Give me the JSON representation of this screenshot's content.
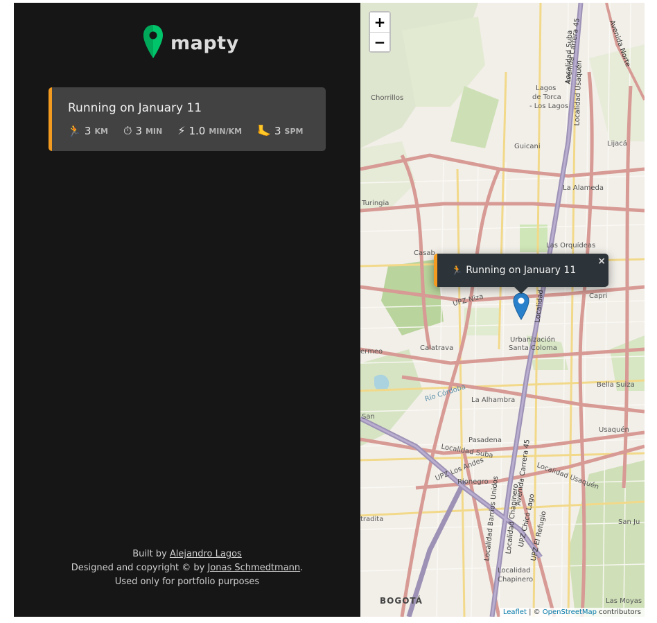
{
  "app": {
    "logo_text": "mapty"
  },
  "workouts": [
    {
      "title": "Running on January 11",
      "accent": "#f39a20",
      "details": [
        {
          "icon": "running-icon",
          "glyph": "🏃",
          "value": "3",
          "unit": "km"
        },
        {
          "icon": "stopwatch-icon",
          "glyph": "⏱",
          "value": "3",
          "unit": "min"
        },
        {
          "icon": "lightning-icon",
          "glyph": "⚡",
          "value": "1.0",
          "unit": "min/km"
        },
        {
          "icon": "footprint-icon",
          "glyph": "🦶",
          "value": "3",
          "unit": "spm"
        }
      ]
    }
  ],
  "footer": {
    "line1_prefix": "Built by ",
    "line1_link": "Alejandro Lagos",
    "line2_prefix": "Designed and copyright © by ",
    "line2_link": "Jonas Schmedtmann",
    "line2_suffix": ".",
    "line3": "Used only for portfolio purposes"
  },
  "map": {
    "zoom_in": "+",
    "zoom_out": "−",
    "popup": {
      "glyph": "🏃",
      "text": "Running on January 11",
      "close": "×"
    },
    "labels": {
      "chorrillos": "Chorrillos",
      "lagos": "Lagos",
      "detorca": "de Torca",
      "loslagos": "- Los Lagos",
      "guicani": "Guicani",
      "lijaca": "Lijacá",
      "alameda": "La Alameda",
      "turingia": "Turingia",
      "orquideas": "Las Orquídeas",
      "casab": "Casab",
      "upzniza": "UPZ Niza",
      "capri": "Capri",
      "urbanizacion": "Urbanización",
      "santacoloma": "Santa Coloma",
      "ermeo": "ermeo",
      "calatrava": "Calatrava",
      "bellasuiza": "Bella Suiza",
      "riocordoba": "Río Córdoba",
      "alhambra": "La Alhambra",
      "usaquen": "Usaquén",
      "pasadena": "Pasadena",
      "locsuba": "Localidad Suba",
      "upzandes": "UPZ Los Andes",
      "rionegro": "Rionegro",
      "locusaquen": "Localidad Usaquén",
      "tradita": "tradita",
      "sanju": "San Ju",
      "localidad": "Localidad",
      "chapinero": "Chapinero",
      "bogota": "BOGOTÁ",
      "lasmoyas": "Las Moyas",
      "san": "San",
      "avcarrera": "Avenida Carrera 45",
      "locsubatop": "Localidad Suba",
      "locusaquentop": "Localidad Usaquén",
      "avcarrera2": "Avenida Carrera 45",
      "locbarrios": "Localidad Barrios Unidos",
      "locchapinero": "Localidad Chapinero",
      "upzchico": "UPZ Chicó Lago",
      "upzrefugio": "UPZ El Refugio",
      "avnorte": "Avenida Norte",
      "localidadv": "Localidad"
    },
    "attribution": {
      "leaflet": "Leaflet",
      "sep": " | © ",
      "osm": "OpenStreetMap",
      "suffix": " contributors"
    }
  }
}
